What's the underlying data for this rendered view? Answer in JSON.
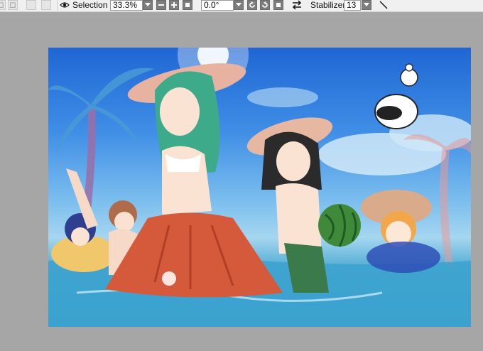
{
  "toolbar": {
    "selection_label": "Selection",
    "zoom_value": "33.3%",
    "rotation_value": "0.0°",
    "stabilizer_label": "Stabilizer",
    "stabilizer_value": "13"
  },
  "icons": {
    "visibility": "eye-icon",
    "zoom_out": "minus-icon",
    "zoom_in": "plus-icon",
    "zoom_reset": "square-icon",
    "rotate_left": "rotate-left-icon",
    "rotate_right": "rotate-right-icon",
    "rotate_reset": "square-icon",
    "flip": "swap-arrows-icon",
    "dropdown": "chevron-down-icon",
    "pen": "diagonal-line-icon"
  },
  "colors": {
    "workspace": "#a6a6a6",
    "toolbar": "#f0f0f0",
    "sky_top": "#1f66d4",
    "water": "#2f8fbf"
  }
}
